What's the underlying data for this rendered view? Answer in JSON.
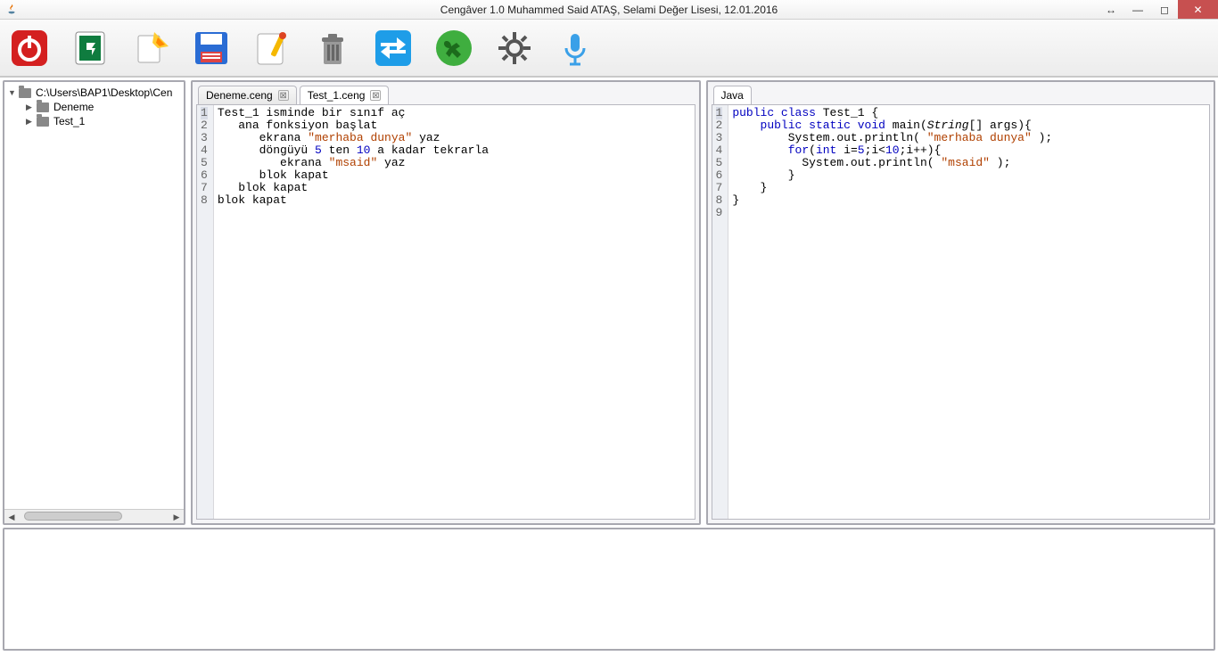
{
  "window": {
    "title": "Cengâver 1.0  Muhammed Said ATAŞ, Selami Değer Lisesi, 12.01.2016"
  },
  "toolbar": {
    "buttons": [
      "power",
      "project",
      "new-file",
      "save",
      "edit",
      "delete",
      "swap",
      "run",
      "settings",
      "microphone"
    ]
  },
  "tree": {
    "root": "C:\\Users\\BAP1\\Desktop\\Cen",
    "children": [
      "Deneme",
      "Test_1"
    ]
  },
  "left_tabs": [
    {
      "label": "Deneme.ceng",
      "active": false
    },
    {
      "label": "Test_1.ceng",
      "active": true
    }
  ],
  "right_tabs": [
    {
      "label": "Java",
      "active": true
    }
  ],
  "left_code": {
    "lines": [
      {
        "n": 1,
        "tokens": [
          [
            "",
            "Test_1 isminde bir sınıf aç"
          ]
        ]
      },
      {
        "n": 2,
        "tokens": [
          [
            "",
            "   ana fonksiyon başlat"
          ]
        ]
      },
      {
        "n": 3,
        "tokens": [
          [
            "",
            "      ekrana "
          ],
          [
            "str",
            "\"merhaba dunya\""
          ],
          [
            "",
            " yaz"
          ]
        ]
      },
      {
        "n": 4,
        "tokens": [
          [
            "",
            "      döngüyü "
          ],
          [
            "num",
            "5"
          ],
          [
            "",
            " ten "
          ],
          [
            "num",
            "10"
          ],
          [
            "",
            " a kadar tekrarla"
          ]
        ]
      },
      {
        "n": 5,
        "tokens": [
          [
            "",
            "         ekrana "
          ],
          [
            "str",
            "\"msaid\""
          ],
          [
            "",
            " yaz"
          ]
        ]
      },
      {
        "n": 6,
        "tokens": [
          [
            "",
            "      blok kapat"
          ]
        ]
      },
      {
        "n": 7,
        "tokens": [
          [
            "",
            "   blok kapat"
          ]
        ]
      },
      {
        "n": 8,
        "tokens": [
          [
            "",
            "blok kapat"
          ]
        ]
      }
    ]
  },
  "right_code": {
    "lines": [
      {
        "n": 1,
        "tokens": [
          [
            "kw",
            "public class"
          ],
          [
            "",
            " Test_1 {"
          ]
        ]
      },
      {
        "n": 2,
        "tokens": [
          [
            "",
            "    "
          ],
          [
            "kw",
            "public static void"
          ],
          [
            "",
            " main("
          ],
          [
            "type",
            "String"
          ],
          [
            "",
            "[] args){"
          ]
        ]
      },
      {
        "n": 3,
        "tokens": [
          [
            "",
            "        System.out.println( "
          ],
          [
            "str",
            "\"merhaba dunya\""
          ],
          [
            "",
            " );"
          ]
        ]
      },
      {
        "n": 4,
        "tokens": [
          [
            "",
            "        "
          ],
          [
            "kw",
            "for"
          ],
          [
            "",
            "("
          ],
          [
            "kw",
            "int"
          ],
          [
            "",
            " i="
          ],
          [
            "num",
            "5"
          ],
          [
            "",
            ";i<"
          ],
          [
            "num",
            "10"
          ],
          [
            "",
            ";i++){"
          ]
        ]
      },
      {
        "n": 5,
        "tokens": [
          [
            "",
            "          System.out.println( "
          ],
          [
            "str",
            "\"msaid\""
          ],
          [
            "",
            " );"
          ]
        ]
      },
      {
        "n": 6,
        "tokens": [
          [
            "",
            "        }"
          ]
        ]
      },
      {
        "n": 7,
        "tokens": [
          [
            "",
            "    }"
          ]
        ]
      },
      {
        "n": 8,
        "tokens": [
          [
            "",
            "}"
          ]
        ]
      },
      {
        "n": 9,
        "tokens": [
          [
            "",
            ""
          ]
        ]
      }
    ]
  }
}
